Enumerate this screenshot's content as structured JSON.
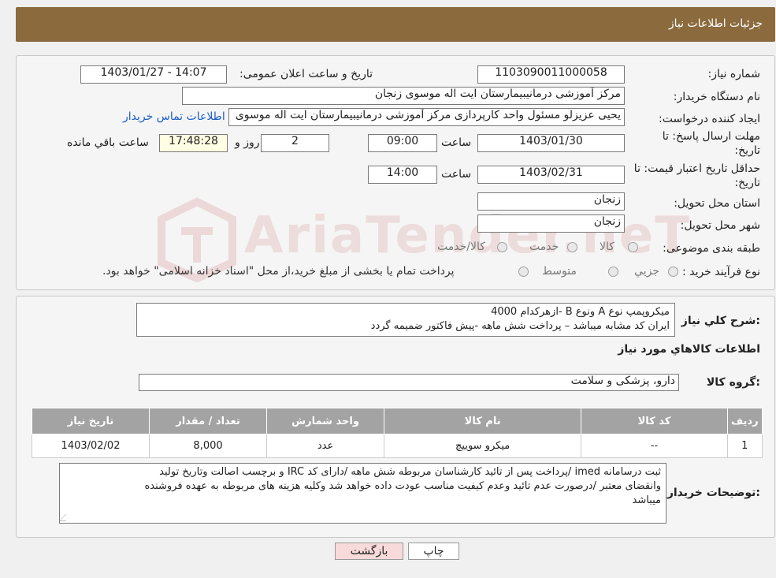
{
  "header": {
    "title": "جزئیات اطلاعات نیاز"
  },
  "form": {
    "need_number_label": "شماره نیاز:",
    "need_number": "1103090011000058",
    "announce_label": "تاریخ و ساعت اعلان عمومی:",
    "announce_value": "1403/01/27 - 14:07",
    "buyer_label": "نام دستگاه خریدار:",
    "buyer_value": "مرکز آموزشی درمانیبیمارستان ایت اله موسوی زنجان",
    "creator_label": "ایجاد کننده درخواست:",
    "creator_value": "یحیی عزیزلو مسئول واحد کارپردازی مرکز آموزشی درمانیبیمارستان ایت اله موسوی",
    "contact_link": "اطلاعات تماس خریدار",
    "deadline_label_1": "مهلت ارسال پاسخ: تا",
    "deadline_label_2": "تاریخ:",
    "deadline_date": "1403/01/30",
    "time_label": "ساعت",
    "deadline_time": "09:00",
    "days_value": "2",
    "days_label": "روز و",
    "remaining_time": "17:48:28",
    "remaining_label": "ساعت باقي مانده",
    "validity_label_1": "حداقل تاریخ اعتبار قیمت: تا",
    "validity_label_2": "تاریخ:",
    "validity_date": "1403/02/31",
    "validity_time": "14:00",
    "province_label": "استان محل تحویل:",
    "province_value": "زنجان",
    "city_label": "شهر محل تحویل:",
    "city_value": "زنجان",
    "category_label": "طبقه بندی موضوعی:",
    "category_options": [
      "کالا",
      "خدمت",
      "کالا/خدمت"
    ],
    "process_label": "نوع فرآیند خرید :",
    "process_options": [
      "جزیي",
      "متوسط"
    ],
    "process_note": "پرداخت تمام یا بخشی از مبلغ خرید،از محل \"اسناد خزانه اسلامی\" خواهد بود."
  },
  "summary": {
    "label": "شرح کلي نياز:",
    "line1": "میکروپمپ نوع A ونوع B -ازهرکدام 4000",
    "line2": "ایران کد مشابه میباشد – پرداخت شش ماهه -پیش فاکتور ضمیمه گردد"
  },
  "goods": {
    "section_title": "اطلاعات کالاهاي مورد نياز",
    "group_label": "گروه کالا:",
    "group_value": "دارو، پزشکی و سلامت",
    "columns": [
      "ردیف",
      "کد کالا",
      "نام کالا",
      "واحد شمارش",
      "تعداد / مقدار",
      "تاریخ نیاز"
    ],
    "rows": [
      {
        "row": "1",
        "code": "--",
        "name": "میکرو سوییچ",
        "unit": "عدد",
        "qty": "8,000",
        "date": "1403/02/02"
      }
    ]
  },
  "notes": {
    "label": "توضیحات خریدار:",
    "line1": "ثبت درسامانه imed /پرداخت پس از تائید کارشناسان مربوطه  شش ماهه /دارای کد IRC  و برچسب اصالت وتاریخ تولید",
    "line2": "وانقضای معتبر /درصورت عدم تائید وعدم کیفیت مناسب عودت داده خواهد شد وکلیه هزینه های مربوطه به عهده فروشنده",
    "line3": "میباشد"
  },
  "buttons": {
    "print": "چاپ",
    "back": "بازگشت"
  },
  "watermark": "AriaTender.neT",
  "colors": {
    "header": "#8b6a3e",
    "link": "#1a5ec8",
    "back_button": "#f8dada"
  }
}
